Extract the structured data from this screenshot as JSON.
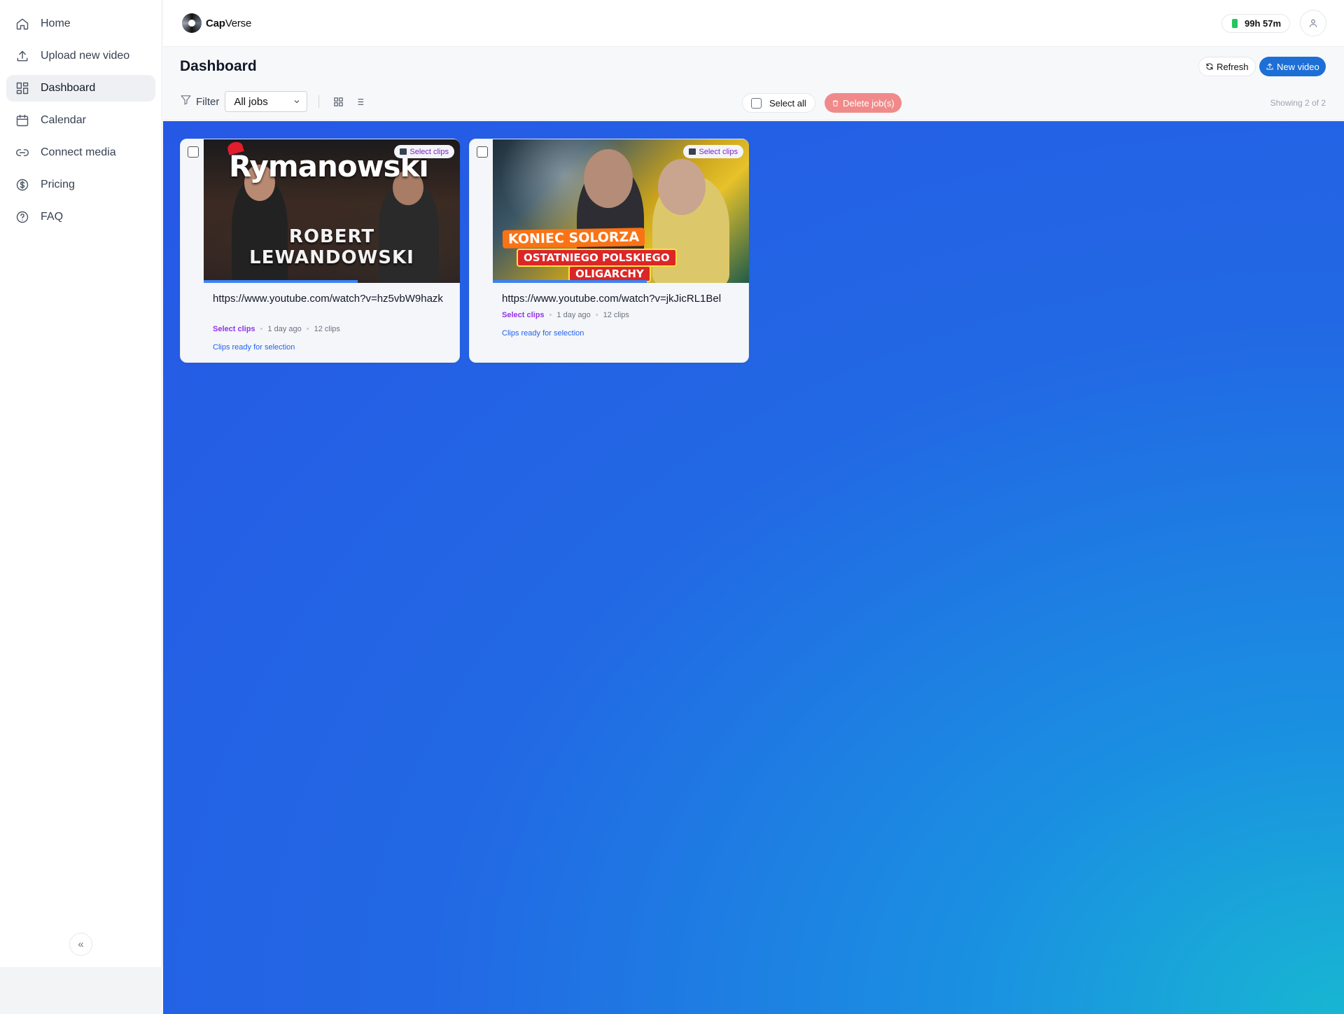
{
  "app": {
    "name_bold": "Cap",
    "name_rest": "Verse",
    "credits": "99h 57m"
  },
  "sidebar": {
    "items": [
      {
        "label": "Home",
        "icon": "home-icon"
      },
      {
        "label": "Upload new video",
        "icon": "upload-icon"
      },
      {
        "label": "Dashboard",
        "icon": "dashboard-icon",
        "active": true
      },
      {
        "label": "Calendar",
        "icon": "calendar-icon"
      },
      {
        "label": "Connect media",
        "icon": "link-icon"
      },
      {
        "label": "Pricing",
        "icon": "dollar-icon"
      },
      {
        "label": "FAQ",
        "icon": "help-icon"
      }
    ],
    "collapse_label": "«"
  },
  "header": {
    "title": "Dashboard",
    "refresh_label": "Refresh",
    "new_video_label": "New video",
    "filter_label": "Filter",
    "filter_value": "All jobs",
    "select_all_label": "Select all",
    "delete_label": "Delete job(s)",
    "showing": "Showing 2 of 2"
  },
  "jobs": [
    {
      "url": "https://www.youtube.com/watch?v=hz5vbW9hazk",
      "status": "Select clips",
      "age": "1 day ago",
      "clips": "12 clips",
      "ready": "Clips ready for selection",
      "badge": "Select clips",
      "thumb_title": "Rymanowski",
      "thumb_line1": "ROBERT",
      "thumb_line2": "LEWANDOWSKI",
      "progress": 0.6
    },
    {
      "url": "https://www.youtube.com/watch?v=jkJicRL1Bel",
      "status": "Select clips",
      "age": "1 day ago",
      "clips": "12 clips",
      "ready": "Clips ready for selection",
      "badge": "Select clips",
      "thumb_line1": "KONIEC SOLORZA",
      "thumb_line2": "OSTATNIEGO POLSKIEGO",
      "thumb_line3": "OLIGARCHY",
      "progress": 0.6
    }
  ],
  "colors": {
    "accent": "#1d6fd6",
    "status": "#9333ea",
    "ready": "#2563eb",
    "delete": "#f08a8a"
  }
}
